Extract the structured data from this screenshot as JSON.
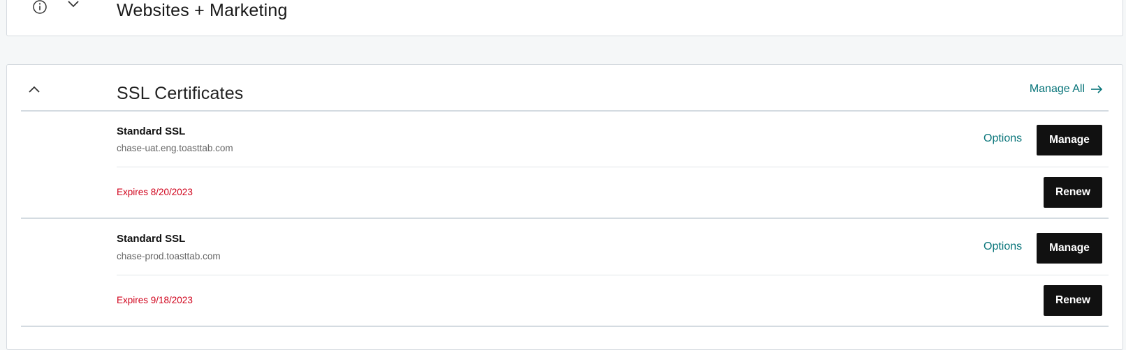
{
  "top_section": {
    "title": "Websites + Marketing",
    "icons": [
      "info-icon",
      "chevron-down-icon"
    ]
  },
  "ssl_section": {
    "title": "SSL Certificates",
    "manage_all_label": "Manage All",
    "manage_all_icon": "arrow-right-icon",
    "collapse_icon": "chevron-up-icon",
    "items": [
      {
        "name": "Standard SSL",
        "domain": "chase-uat.eng.toasttab.com",
        "options_label": "Options",
        "manage_label": "Manage",
        "expires": "Expires 8/20/2023",
        "renew_label": "Renew"
      },
      {
        "name": "Standard SSL",
        "domain": "chase-prod.toasttab.com",
        "options_label": "Options",
        "manage_label": "Manage",
        "expires": "Expires 9/18/2023",
        "renew_label": "Renew"
      }
    ]
  },
  "colors": {
    "page_background": "#f5f7f8",
    "link_teal": "#09757a",
    "expires_red": "#d0021b",
    "button_black": "#111111",
    "divider": "#d4dbe1"
  }
}
